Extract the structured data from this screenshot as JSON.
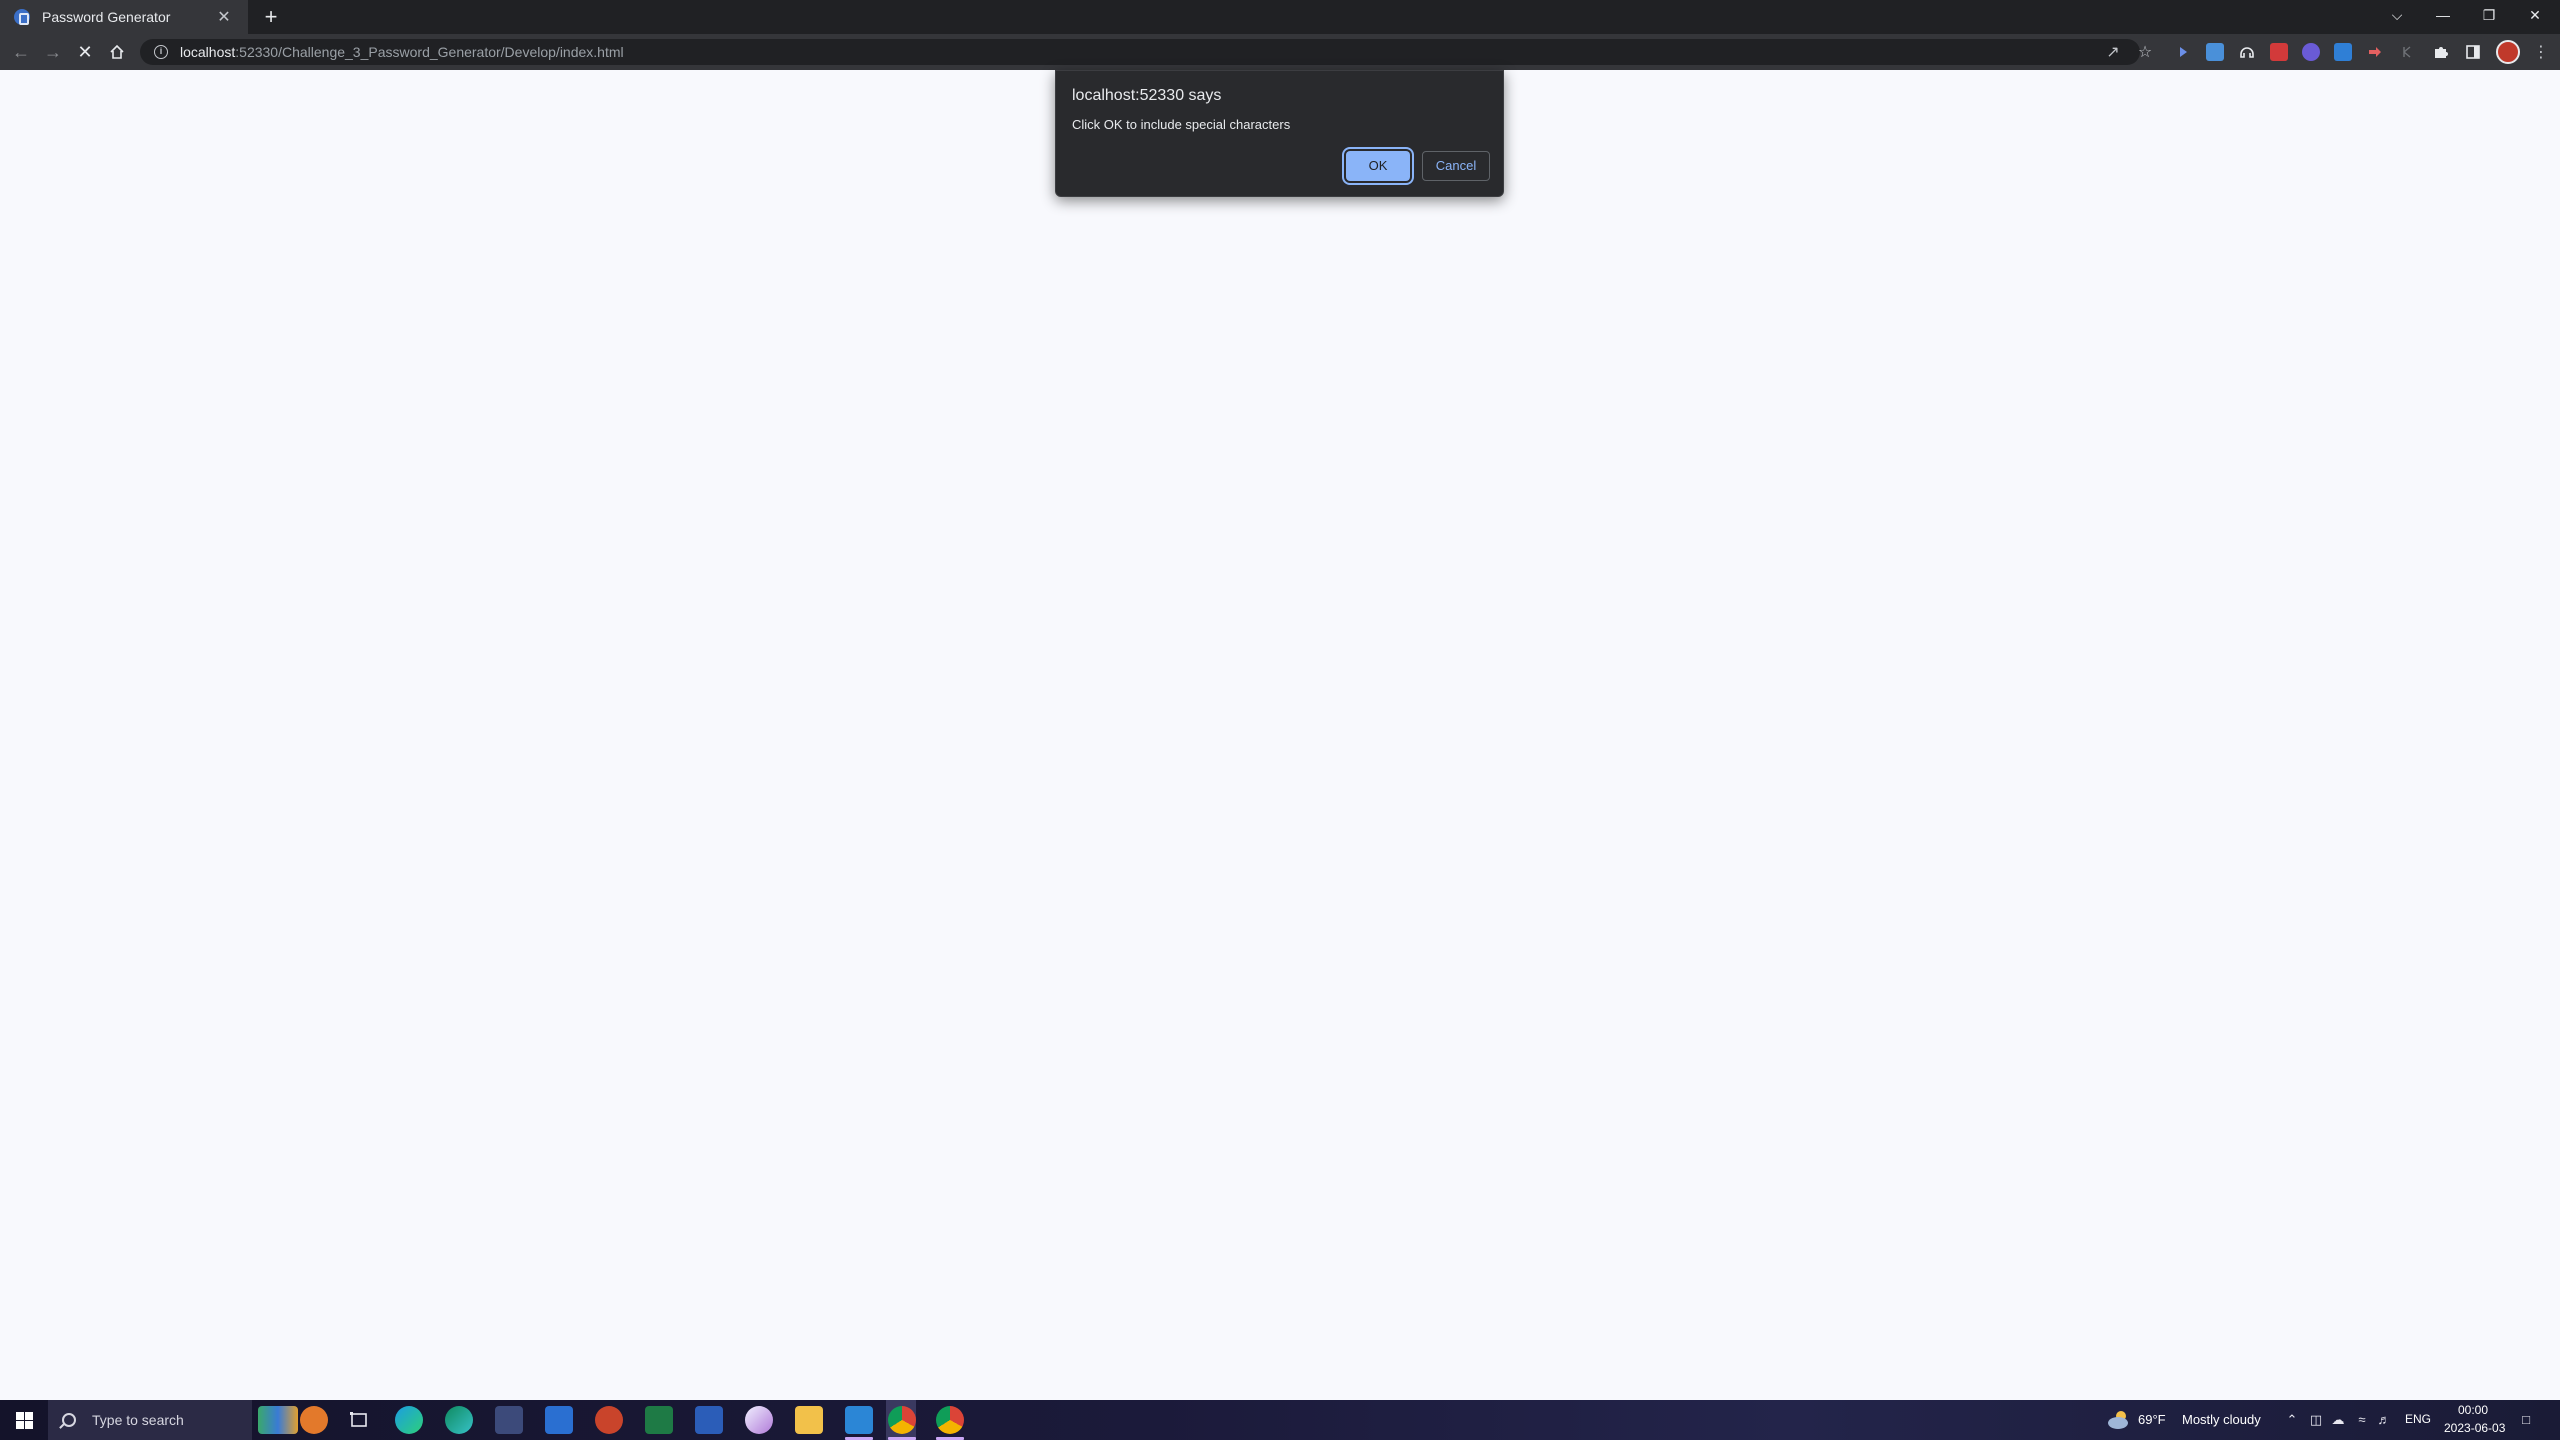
{
  "browser": {
    "tab": {
      "title": "Password Generator",
      "close_glyph": "✕"
    },
    "new_tab_glyph": "+",
    "address": {
      "host": "localhost",
      "rest": ":52330/Challenge_3_Password_Generator/Develop/index.html"
    },
    "window_controls": {
      "tab_search": "⌵",
      "minimize": "—",
      "restore": "❐",
      "close": "✕"
    }
  },
  "dialog": {
    "title": "localhost:52330 says",
    "message": "Click OK to include special characters",
    "ok_label": "OK",
    "cancel_label": "Cancel"
  },
  "taskbar": {
    "search_placeholder": "Type to search",
    "weather": {
      "temp": "69°F",
      "condition": "Mostly cloudy"
    },
    "language": "ENG",
    "time": "00:00",
    "date": "2023-06-03"
  },
  "colors": {
    "accent": "#8ab4f8",
    "dialog_bg": "#292a2d",
    "page_bg": "#f8f9fd",
    "chrome_dark": "#202124"
  }
}
